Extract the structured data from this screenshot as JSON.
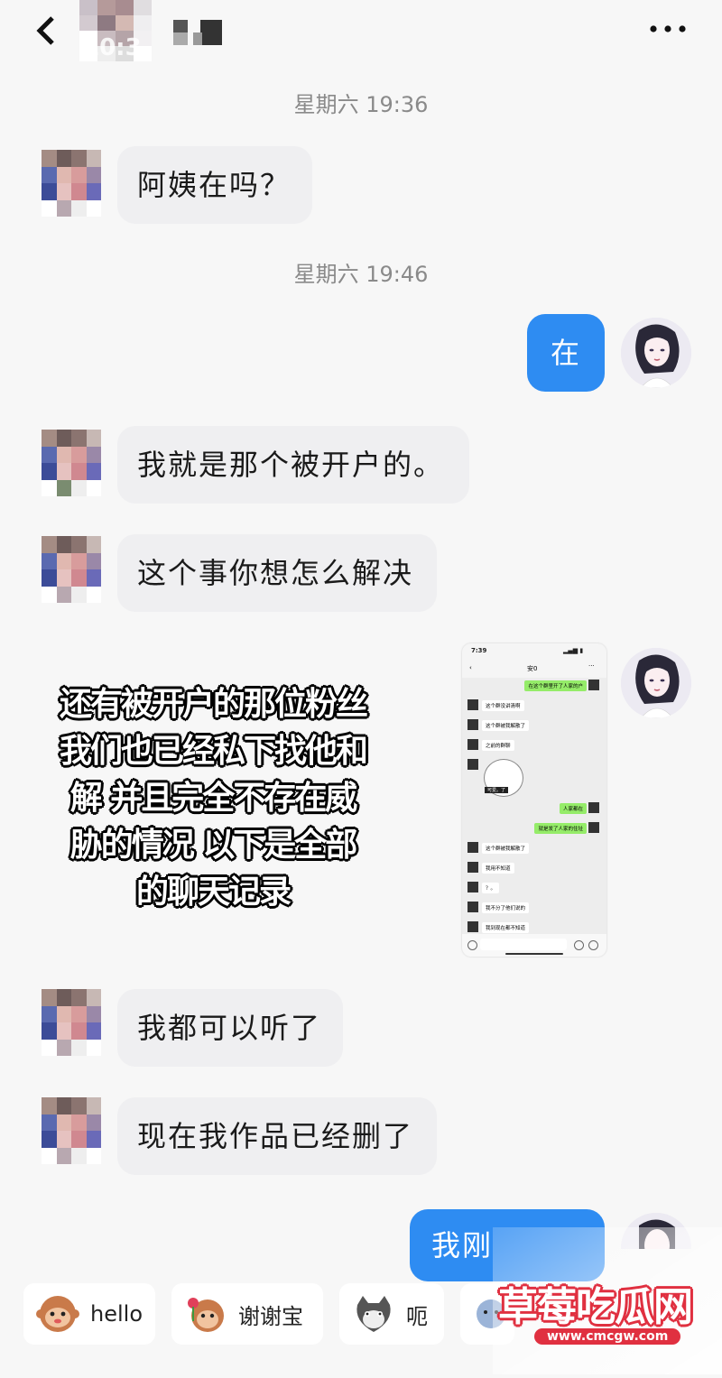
{
  "header": {
    "back_icon": "chevron-left-icon",
    "blurred_name": "10:3",
    "more_icon": "more-dots-icon",
    "more_label": "•••"
  },
  "messages": [
    {
      "type": "time",
      "text": "星期六 19:36"
    },
    {
      "type": "received",
      "text": "阿姨在吗？"
    },
    {
      "type": "time",
      "text": "星期六 19:46"
    },
    {
      "type": "sent",
      "text": "在"
    },
    {
      "type": "received",
      "text": "我就是那个被开户的。"
    },
    {
      "type": "received",
      "text": "这个事你想怎么解决"
    },
    {
      "type": "sent-image",
      "caption": "image-screenshot"
    },
    {
      "type": "received",
      "text": "我都可以听了"
    },
    {
      "type": "received",
      "text": "现在我作品已经删了"
    },
    {
      "type": "sent",
      "text": "我刚"
    }
  ],
  "overlay": {
    "lines": [
      "还有被开户的那位粉丝",
      "我们也已经私下找他和",
      "解 并且完全不存在威",
      "胁的情况 以下是全部",
      "的聊天记录"
    ]
  },
  "embedded_screenshot": {
    "status_time": "7:39",
    "title": "安0",
    "bubbles": [
      {
        "side": "right",
        "text": "在这个群里开了人家的户"
      },
      {
        "side": "left",
        "text": "这个群没讲清啊"
      },
      {
        "side": "left",
        "text": "这个群被我解散了"
      },
      {
        "side": "left",
        "text": "之前的群聊"
      },
      {
        "side": "left",
        "text": "sticker"
      },
      {
        "side": "right",
        "text": "人家都在"
      },
      {
        "side": "right",
        "text": "就是发了人家的住址"
      },
      {
        "side": "left",
        "text": "这个群被我解散了"
      },
      {
        "side": "left",
        "text": "我用不知道"
      },
      {
        "side": "left",
        "text": "？。"
      },
      {
        "side": "left",
        "text": "我不分了他们说的"
      },
      {
        "side": "left",
        "text": "我到现在都不知道"
      }
    ],
    "sticker_label": "可爱。了"
  },
  "quick_replies": [
    {
      "label": "hello",
      "icon": "monkey-icon",
      "color": "#c97a4a"
    },
    {
      "label": "谢谢宝",
      "icon": "monkey-flower-icon",
      "color": "#c97a4a"
    },
    {
      "label": "呃",
      "icon": "cat-icon",
      "color": "#666"
    },
    {
      "label": "",
      "icon": "sticker-icon",
      "color": "#9bb4d8"
    }
  ],
  "watermark": {
    "title": "草莓吃瓜网",
    "url": "www.cmcgw.com"
  },
  "colors": {
    "sent_bubble": "#2e8cf2",
    "received_bubble": "#efeff1",
    "background": "#f7f7f7",
    "watermark_red": "#e03040"
  }
}
